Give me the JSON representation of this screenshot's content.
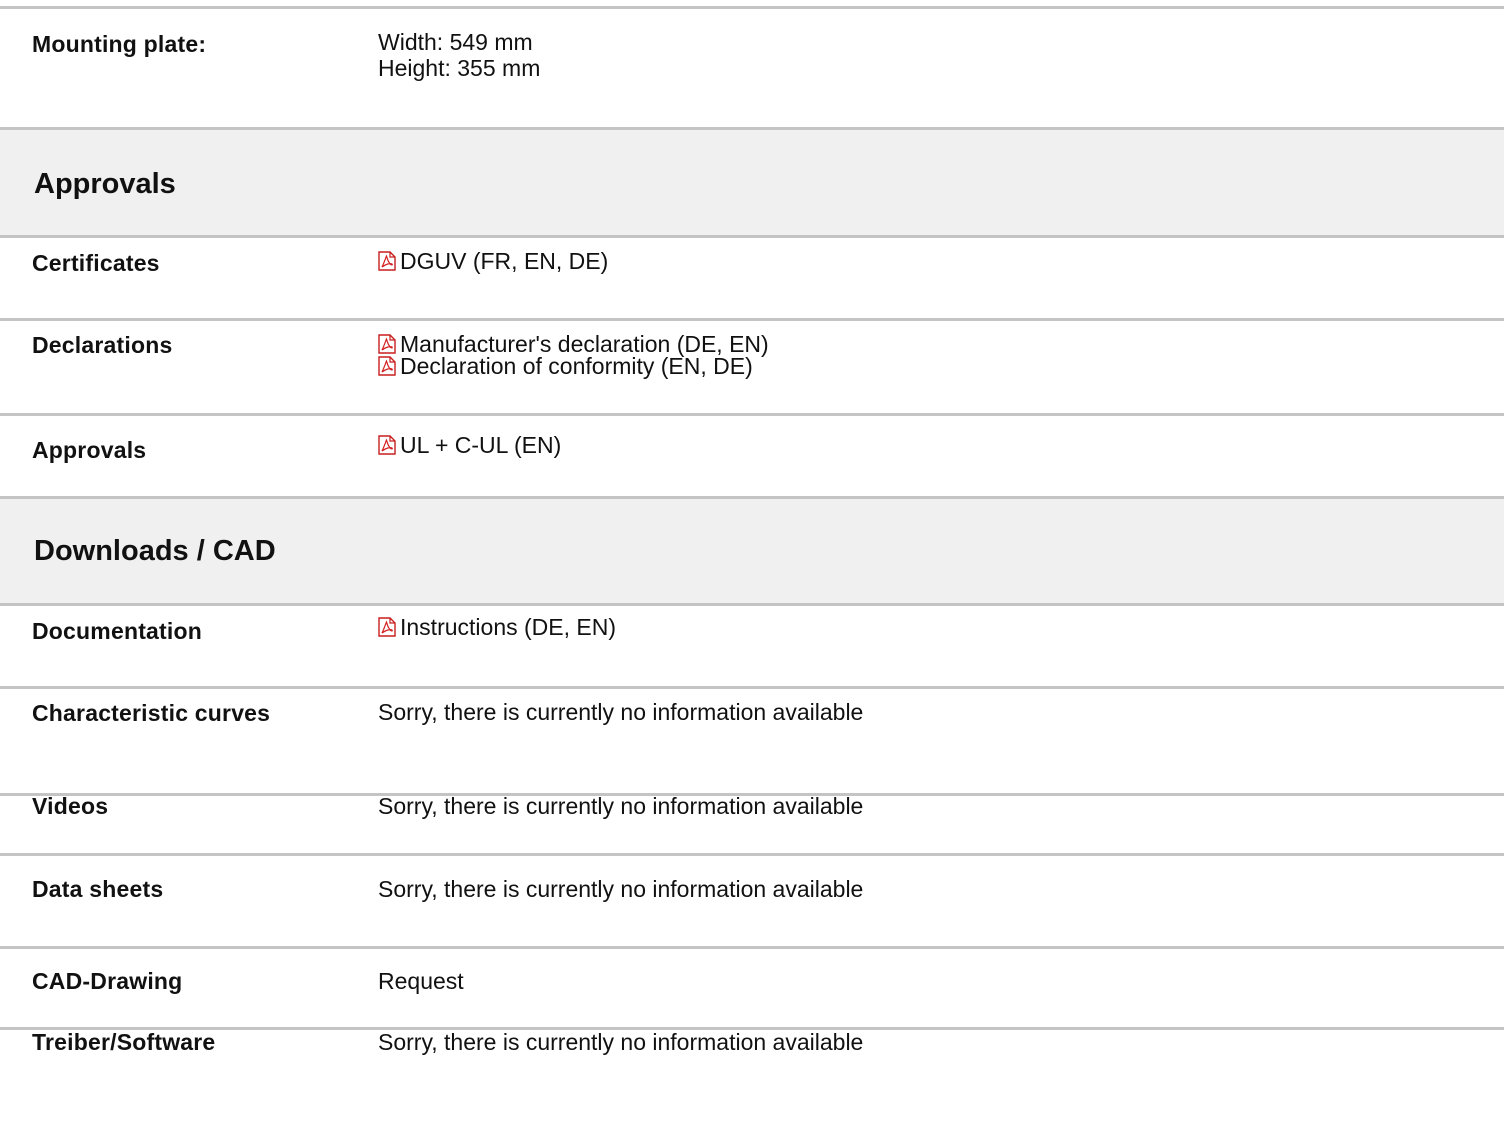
{
  "mounting_plate": {
    "label": "Mounting plate:",
    "width": "Width: 549 mm",
    "height": "Height: 355 mm"
  },
  "approvals_section": {
    "title": "Approvals",
    "rows": {
      "certificates": {
        "label": "Certificates",
        "links": [
          "DGUV (FR, EN, DE)"
        ]
      },
      "declarations": {
        "label": "Declarations",
        "links": [
          "Manufacturer's declaration (DE, EN)",
          "Declaration of conformity (EN, DE)"
        ]
      },
      "approvals": {
        "label": "Approvals",
        "links": [
          "UL + C-UL (EN)"
        ]
      }
    }
  },
  "downloads_section": {
    "title": "Downloads / CAD",
    "rows": {
      "documentation": {
        "label": "Documentation",
        "links": [
          "Instructions (DE, EN)"
        ]
      },
      "characteristic_curves": {
        "label": "Characteristic curves",
        "value": "Sorry, there is currently no information available"
      },
      "videos": {
        "label": "Videos",
        "value": "Sorry, there is currently no information available"
      },
      "data_sheets": {
        "label": "Data sheets",
        "value": "Sorry, there is currently no information available"
      },
      "cad_drawing": {
        "label": "CAD-Drawing",
        "value": "Request"
      },
      "treiber_software": {
        "label": "Treiber/Software",
        "value": "Sorry, there is currently no information available"
      }
    }
  },
  "icons": {
    "pdf": "pdf-file-icon"
  },
  "colors": {
    "divider": "#c4c4c4",
    "section_bg": "#f0f0f0",
    "pdf_red": "#d42020"
  }
}
